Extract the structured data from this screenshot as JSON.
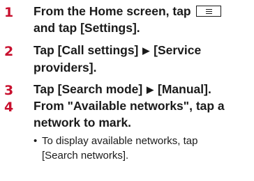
{
  "steps": [
    {
      "number": "1",
      "line1_before": "From the Home screen, tap",
      "menu_icon": "menu-key-icon",
      "line2": "and tap [Settings]."
    },
    {
      "number": "2",
      "line1_a": "Tap [Call settings]",
      "line1_b": "[Service",
      "line2": "providers]."
    },
    {
      "number": "3",
      "line1_a": "Tap [Search mode]",
      "line1_b": "[Manual]."
    },
    {
      "number": "4",
      "line1": "From \"Available networks\", tap a",
      "line2": "network to mark.",
      "note_bullet": "•",
      "note_line1": "To display available networks, tap",
      "note_line2": "[Search networks]."
    }
  ],
  "arrow_glyph": "▶"
}
